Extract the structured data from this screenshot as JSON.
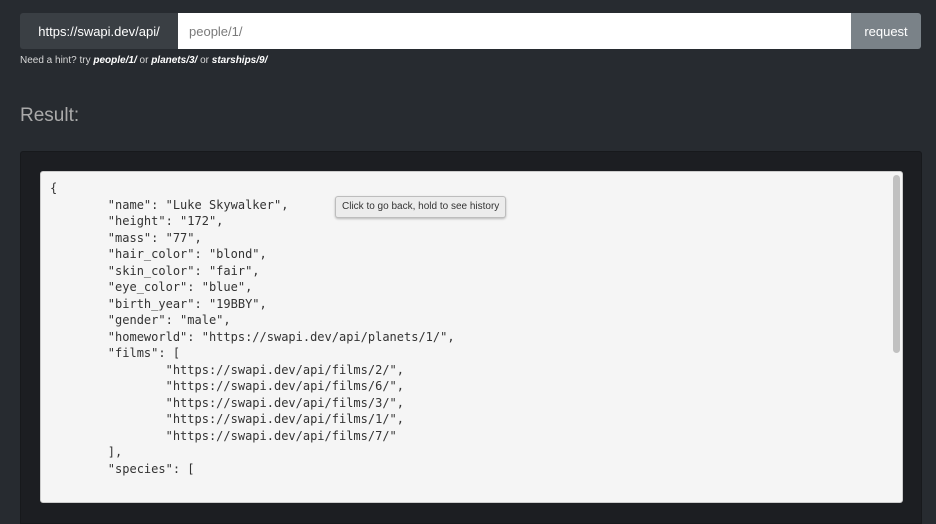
{
  "url_bar": {
    "prefix": "https://swapi.dev/api/",
    "input_value": "people/1/",
    "request_label": "request"
  },
  "hint": {
    "lead": "Need a hint? try ",
    "example_1": "people/1/",
    "or_1": " or ",
    "example_2": "planets/3/",
    "or_2": " or ",
    "example_3": "starships/9/"
  },
  "result": {
    "heading": "Result:",
    "json_text": "{\n\t\"name\": \"Luke Skywalker\",\n\t\"height\": \"172\",\n\t\"mass\": \"77\",\n\t\"hair_color\": \"blond\",\n\t\"skin_color\": \"fair\",\n\t\"eye_color\": \"blue\",\n\t\"birth_year\": \"19BBY\",\n\t\"gender\": \"male\",\n\t\"homeworld\": \"https://swapi.dev/api/planets/1/\",\n\t\"films\": [\n\t\t\"https://swapi.dev/api/films/2/\",\n\t\t\"https://swapi.dev/api/films/6/\",\n\t\t\"https://swapi.dev/api/films/3/\",\n\t\t\"https://swapi.dev/api/films/1/\",\n\t\t\"https://swapi.dev/api/films/7/\"\n\t],\n\t\"species\": ["
  },
  "tooltip": {
    "text": "Click to go back, hold to see history"
  },
  "colors": {
    "page_background": "#272b30",
    "well_background": "#1c1e22",
    "request_button": "#7a8288",
    "url_prefix_background": "#3a3f44"
  }
}
